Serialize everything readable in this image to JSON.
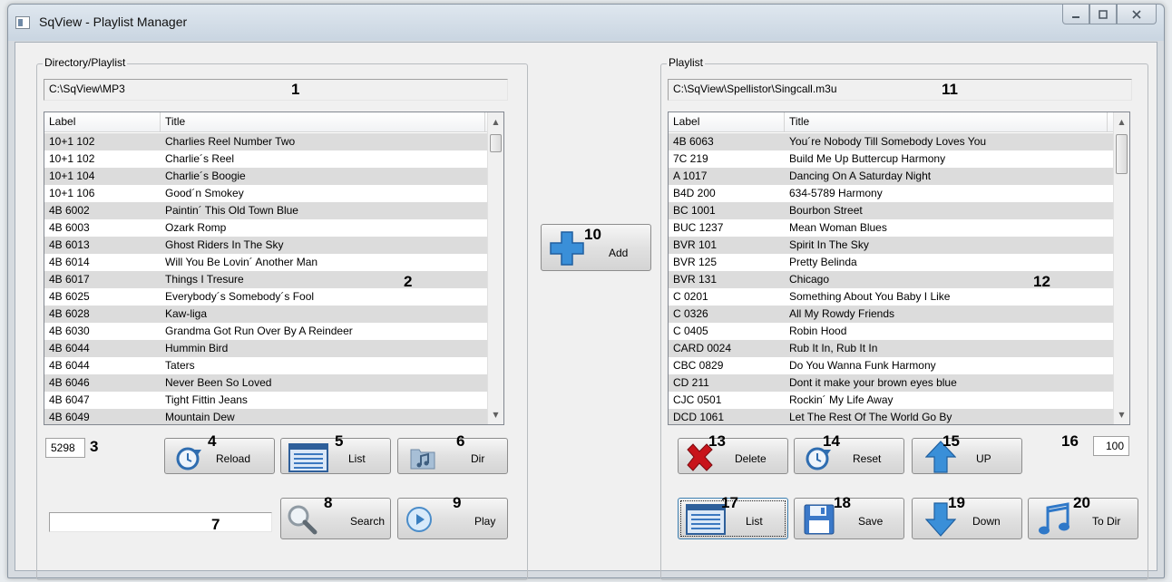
{
  "window": {
    "title": "SqView - Playlist Manager"
  },
  "left": {
    "group_label": "Directory/Playlist",
    "path": "C:\\SqView\\MP3",
    "columns": {
      "label": "Label",
      "title": "Title"
    },
    "rows": [
      {
        "label": "10+1 102",
        "title": "Charlies Reel Number Two"
      },
      {
        "label": "10+1 102",
        "title": "Charlie´s Reel"
      },
      {
        "label": "10+1 104",
        "title": "Charlie´s Boogie"
      },
      {
        "label": "10+1 106",
        "title": "Good´n Smokey"
      },
      {
        "label": "4B 6002",
        "title": "Paintin´ This Old Town Blue"
      },
      {
        "label": "4B 6003",
        "title": "Ozark Romp"
      },
      {
        "label": "4B 6013",
        "title": "Ghost Riders In The Sky"
      },
      {
        "label": "4B 6014",
        "title": "Will You Be Lovin´ Another Man"
      },
      {
        "label": "4B 6017",
        "title": "Things I Tresure"
      },
      {
        "label": "4B 6025",
        "title": "Everybody´s Somebody´s Fool"
      },
      {
        "label": "4B 6028",
        "title": "Kaw-liga"
      },
      {
        "label": "4B 6030",
        "title": "Grandma Got Run Over By A Reindeer"
      },
      {
        "label": "4B 6044",
        "title": "Hummin Bird"
      },
      {
        "label": "4B 6044",
        "title": "Taters"
      },
      {
        "label": "4B 6046",
        "title": "Never Been So Loved"
      },
      {
        "label": "4B 6047",
        "title": "Tight Fittin Jeans"
      },
      {
        "label": "4B 6049",
        "title": "Mountain Dew"
      }
    ],
    "count": "5298",
    "search_value": ""
  },
  "right": {
    "group_label": "Playlist",
    "path": "C:\\SqView\\Spellistor\\Singcall.m3u",
    "columns": {
      "label": "Label",
      "title": "Title"
    },
    "rows": [
      {
        "label": "4B 6063",
        "title": "You´re Nobody Till Somebody Loves You"
      },
      {
        "label": "7C 219",
        "title": "Build Me Up Buttercup Harmony"
      },
      {
        "label": "A 1017",
        "title": "Dancing On A Saturday Night"
      },
      {
        "label": "B4D 200",
        "title": "634-5789 Harmony"
      },
      {
        "label": "BC 1001",
        "title": "Bourbon Street"
      },
      {
        "label": "BUC 1237",
        "title": "Mean Woman Blues"
      },
      {
        "label": "BVR 101",
        "title": "Spirit In The Sky"
      },
      {
        "label": "BVR 125",
        "title": "Pretty Belinda"
      },
      {
        "label": "BVR 131",
        "title": "Chicago"
      },
      {
        "label": "C 0201",
        "title": "Something About You Baby I Like"
      },
      {
        "label": "C 0326",
        "title": "All My Rowdy Friends"
      },
      {
        "label": "C 0405",
        "title": "Robin Hood"
      },
      {
        "label": "CARD 0024",
        "title": "Rub It In, Rub It In"
      },
      {
        "label": "CBC 0829",
        "title": "Do You Wanna Funk Harmony"
      },
      {
        "label": "CD 211",
        "title": "Dont it make your brown eyes blue"
      },
      {
        "label": "CJC 0501",
        "title": "Rockin´ My Life Away"
      },
      {
        "label": "DCD 1061",
        "title": "Let The Rest Of The World Go By"
      }
    ],
    "step_value": "100"
  },
  "buttons": {
    "reload": "Reload",
    "list_left": "List",
    "dir": "Dir",
    "search": "Search",
    "play": "Play",
    "add": "Add",
    "delete": "Delete",
    "reset": "Reset",
    "up": "UP",
    "list_right": "List",
    "save": "Save",
    "down": "Down",
    "to_dir": "To Dir"
  },
  "callouts": {
    "n1": "1",
    "n2": "2",
    "n3": "3",
    "n4": "4",
    "n5": "5",
    "n6": "6",
    "n7": "7",
    "n8": "8",
    "n9": "9",
    "n10": "10",
    "n11": "11",
    "n12": "12",
    "n13": "13",
    "n14": "14",
    "n15": "15",
    "n16": "16",
    "n17": "17",
    "n18": "18",
    "n19": "19",
    "n20": "20"
  },
  "colors": {
    "accent_blue": "#3a8fd8",
    "delete_red": "#c8141b",
    "row_stripe": "#dcdcdc"
  },
  "icons": {
    "reload": "circular-arrow-icon",
    "list": "list-window-icon",
    "dir": "music-folder-icon",
    "search": "magnifier-icon",
    "play": "play-circle-icon",
    "add": "plus-icon",
    "delete": "red-x-icon",
    "up": "up-arrow-icon",
    "down": "down-arrow-icon",
    "save": "floppy-disk-icon",
    "to_dir": "music-note-icon"
  }
}
